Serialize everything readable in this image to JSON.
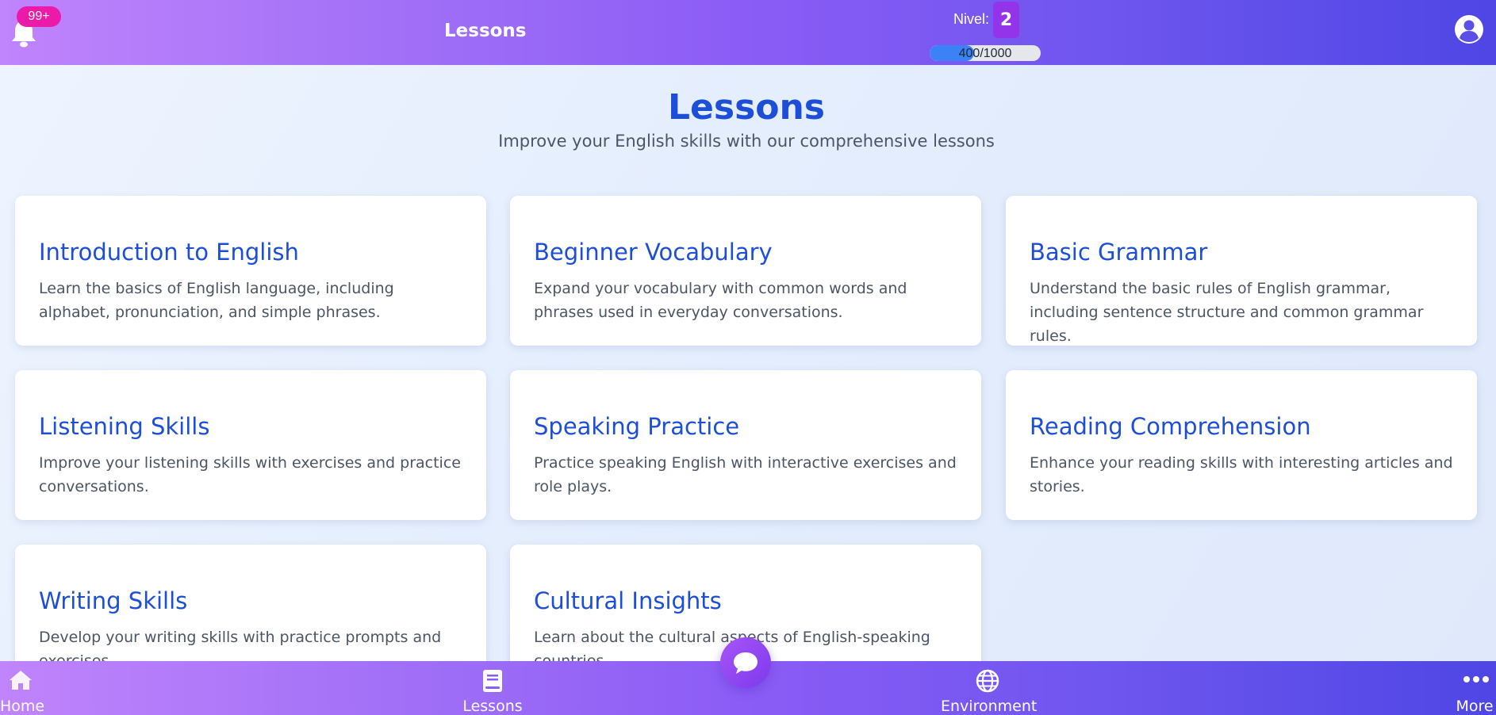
{
  "header": {
    "notifications_badge": "99+",
    "title": "Lessons",
    "level_label": "Nivel:",
    "level_value": "2",
    "xp_text": "400/1000",
    "xp_progress": 0.4
  },
  "main": {
    "title": "Lessons",
    "subtitle": "Improve your English skills with our comprehensive lessons",
    "lessons": [
      {
        "title": "Introduction to English",
        "description": "Learn the basics of English language, including alphabet, pronunciation, and simple phrases."
      },
      {
        "title": "Beginner Vocabulary",
        "description": "Expand your vocabulary with common words and phrases used in everyday conversations."
      },
      {
        "title": "Basic Grammar",
        "description": "Understand the basic rules of English grammar, including sentence structure and common grammar rules."
      },
      {
        "title": "Listening Skills",
        "description": "Improve your listening skills with exercises and practice conversations."
      },
      {
        "title": "Speaking Practice",
        "description": "Practice speaking English with interactive exercises and role plays."
      },
      {
        "title": "Reading Comprehension",
        "description": "Enhance your reading skills with interesting articles and stories."
      },
      {
        "title": "Writing Skills",
        "description": "Develop your writing skills with practice prompts and exercises."
      },
      {
        "title": "Cultural Insights",
        "description": "Learn about the cultural aspects of English-speaking countries."
      }
    ]
  },
  "bottom_nav": {
    "items": [
      {
        "label": "Home",
        "icon": "home-icon"
      },
      {
        "label": "Lessons",
        "icon": "book-icon"
      },
      {
        "label": "Environment",
        "icon": "globe-icon"
      },
      {
        "label": "More",
        "icon": "more-icon"
      }
    ],
    "chat_icon": "chat-icon"
  },
  "colors": {
    "accent": "#1d4ed8",
    "badge": "#ec1aa8",
    "level": "#9333ea",
    "progress": "#3b82f6"
  }
}
